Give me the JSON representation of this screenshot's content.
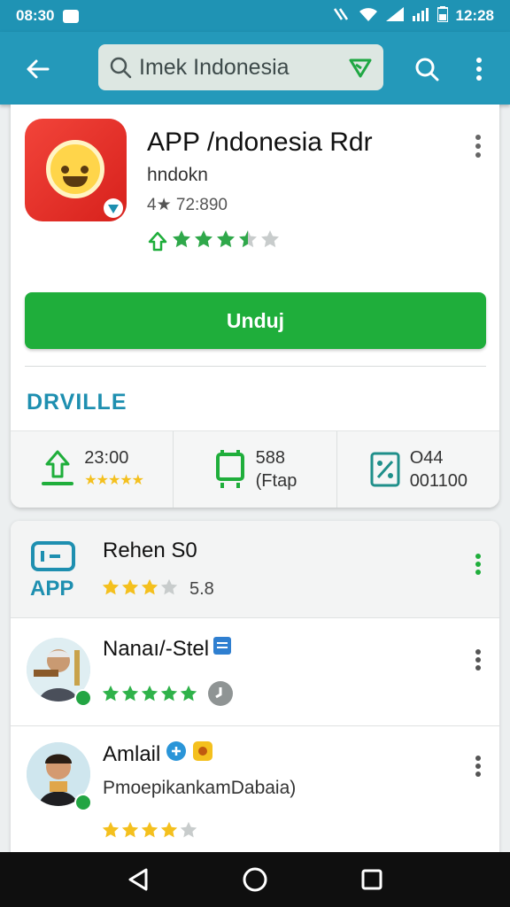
{
  "status_bar": {
    "time_left": "08:30",
    "time_right": "12:28"
  },
  "search": {
    "value": "Imek Indonesia"
  },
  "app": {
    "title": "APP /ndonesia Rdr",
    "developer": "hndokn",
    "meta": "4★ 72:890",
    "rating_stars": 3.5,
    "install_label": "Unduj",
    "section_label": "DRVILLE"
  },
  "stats": [
    {
      "line1": "23:00",
      "line2": ""
    },
    {
      "line1": "588",
      "line2": "(Ftap"
    },
    {
      "line1": "O44",
      "line2": "001100"
    }
  ],
  "list": [
    {
      "title": "Rehen S0",
      "icon_caption": "APP",
      "rating_text": "5.8",
      "stars": 3
    },
    {
      "title": "Nanaı/-Stel",
      "stars": 5
    },
    {
      "title": "Amlail",
      "subtitle": "PmoepikankamDabaia)",
      "stars": 4
    }
  ],
  "colors": {
    "primary": "#2499ba",
    "install_green": "#1fae3b",
    "star": "#f4c01e",
    "section_blue": "#1e8fb0"
  }
}
